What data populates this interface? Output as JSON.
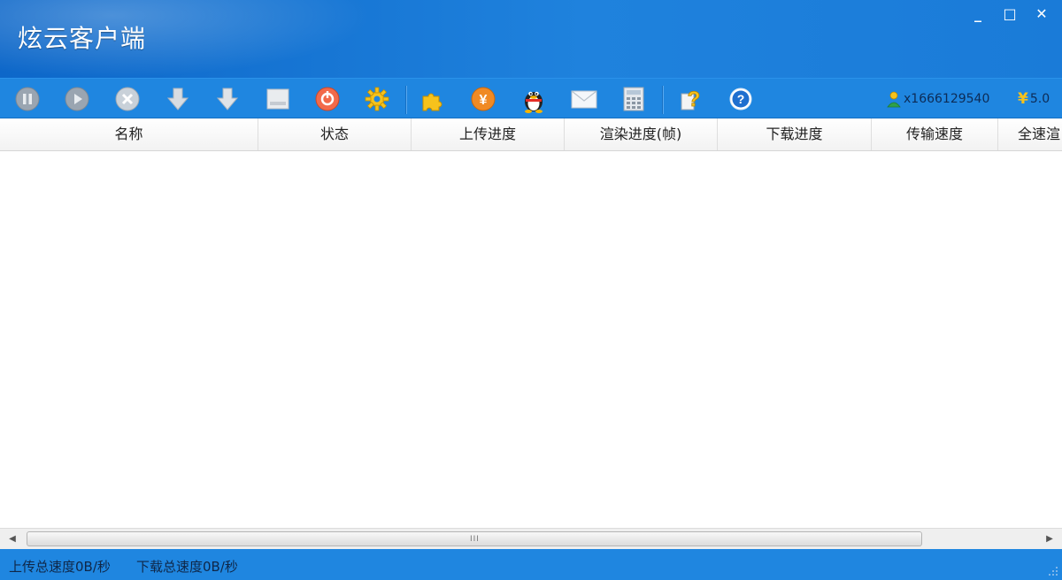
{
  "app": {
    "title": "炫云客户端"
  },
  "window_controls": {
    "minimize": "_",
    "maximize": "□",
    "close": "✕"
  },
  "toolbar": {
    "icons": [
      "pause-icon",
      "play-icon",
      "delete-icon",
      "upload-icon",
      "download-icon",
      "image-icon",
      "stop-icon",
      "settings-icon",
      "plugin-icon",
      "recharge-icon",
      "qq-icon",
      "mail-icon",
      "calculator-icon",
      "help-doc-icon",
      "help-icon"
    ],
    "account": "x1666129540",
    "balance": "5.0"
  },
  "table": {
    "columns": [
      "名称",
      "状态",
      "上传进度",
      "渲染进度(帧)",
      "下载进度",
      "传输速度",
      "全速渲"
    ],
    "rows": []
  },
  "scrollbar": {
    "grip": "III"
  },
  "status": {
    "upload_speed": "上传总速度0B/秒",
    "download_speed": "下载总速度0B/秒"
  },
  "colors": {
    "titlebar": "#1a7bd8",
    "toolbar": "#1f86e0",
    "statusbar": "#1f86e0"
  }
}
